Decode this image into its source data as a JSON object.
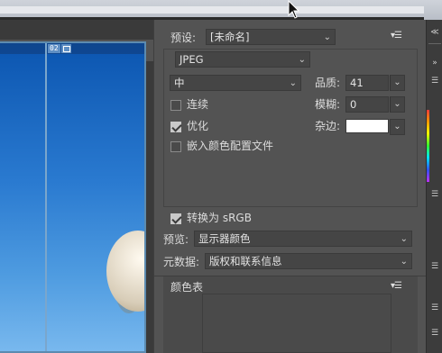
{
  "preset": {
    "label": "预设:",
    "value": "[未命名]"
  },
  "format": {
    "value": "JPEG"
  },
  "quality_level": {
    "value": "中"
  },
  "quality": {
    "label": "品质:",
    "value": "41"
  },
  "blur": {
    "label": "模糊:",
    "value": "0"
  },
  "matte": {
    "label": "杂边:",
    "color": "#ffffff"
  },
  "options": {
    "progressive": {
      "label": "连续",
      "checked": false
    },
    "optimized": {
      "label": "优化",
      "checked": true
    },
    "embed_profile": {
      "label": "嵌入颜色配置文件",
      "checked": false
    }
  },
  "convert_srgb": {
    "label": "转换为 sRGB",
    "checked": true
  },
  "preview": {
    "label": "预览:",
    "value": "显示器颜色"
  },
  "metadata": {
    "label": "元数据:",
    "value": "版权和联系信息"
  },
  "color_table": {
    "title": "颜色表"
  },
  "slice": {
    "number": "02"
  },
  "icons": {
    "panel_menu": "panel-menu-icon",
    "dropdown": "chevron-down-icon",
    "cursor": "mouse-cursor-icon",
    "slice_link": "slice-link-icon",
    "collapse": "double-chevron-icon",
    "grip": "grip-icon"
  },
  "colors": {
    "panel_bg": "#535353",
    "field_bg": "#454545",
    "accent_blue": "#5f8fc4"
  }
}
